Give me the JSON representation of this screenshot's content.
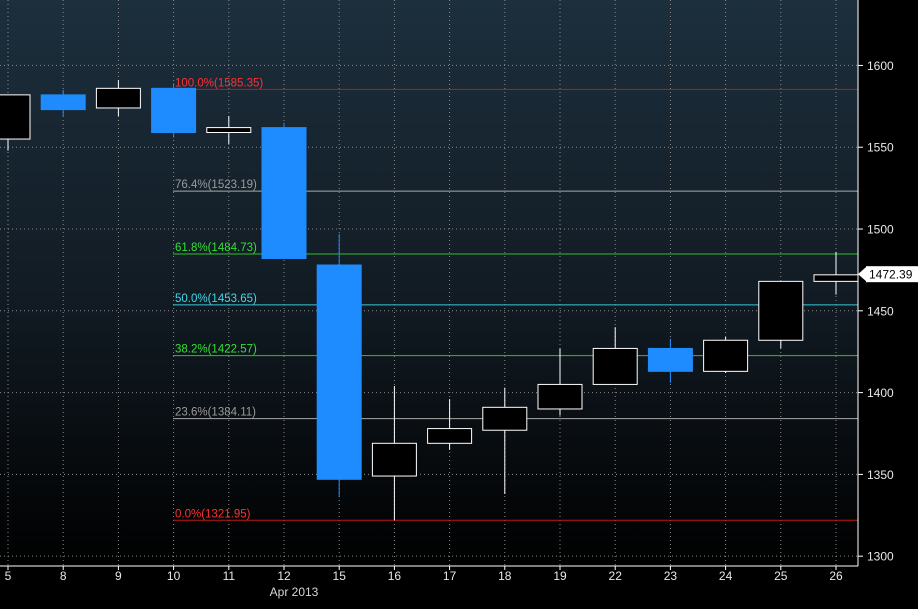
{
  "chart_data": {
    "type": "candlestick",
    "title": "",
    "xlabel": "Apr 2013",
    "ylabel": "",
    "ylim": [
      1294,
      1640
    ],
    "y_ticks": [
      1300,
      1350,
      1400,
      1450,
      1500,
      1550,
      1600
    ],
    "grid": true,
    "last_price_label": "1472.39",
    "last_price": 1472.39,
    "categories": [
      "5",
      "8",
      "9",
      "10",
      "11",
      "12",
      "15",
      "16",
      "17",
      "18",
      "19",
      "22",
      "23",
      "24",
      "25",
      "26"
    ],
    "candles": [
      {
        "x": "5",
        "open": 1555,
        "high": 1580,
        "low": 1548,
        "close": 1582,
        "color": "white"
      },
      {
        "x": "8",
        "open": 1582,
        "high": 1585,
        "low": 1569,
        "close": 1573,
        "color": "blue"
      },
      {
        "x": "9",
        "open": 1574,
        "high": 1591,
        "low": 1569,
        "close": 1586,
        "color": "white"
      },
      {
        "x": "10",
        "open": 1586,
        "high": 1589,
        "low": 1556,
        "close": 1559,
        "color": "blue"
      },
      {
        "x": "11",
        "open": 1559,
        "high": 1569,
        "low": 1552,
        "close": 1562,
        "color": "white"
      },
      {
        "x": "12",
        "open": 1562,
        "high": 1565,
        "low": 1482,
        "close": 1482,
        "color": "blue"
      },
      {
        "x": "15",
        "open": 1478,
        "high": 1497,
        "low": 1336,
        "close": 1347,
        "color": "blue"
      },
      {
        "x": "16",
        "open": 1349,
        "high": 1404,
        "low": 1322,
        "close": 1369,
        "color": "white"
      },
      {
        "x": "17",
        "open": 1369,
        "high": 1396,
        "low": 1365,
        "close": 1378,
        "color": "white"
      },
      {
        "x": "18",
        "open": 1377,
        "high": 1403,
        "low": 1338,
        "close": 1391,
        "color": "white"
      },
      {
        "x": "19",
        "open": 1390,
        "high": 1427,
        "low": 1386,
        "close": 1405,
        "color": "white"
      },
      {
        "x": "22",
        "open": 1405,
        "high": 1440,
        "low": 1405,
        "close": 1427,
        "color": "white"
      },
      {
        "x": "23",
        "open": 1427,
        "high": 1433,
        "low": 1406,
        "close": 1413,
        "color": "blue"
      },
      {
        "x": "24",
        "open": 1413,
        "high": 1434,
        "low": 1412,
        "close": 1432,
        "color": "white"
      },
      {
        "x": "25",
        "open": 1432,
        "high": 1468,
        "low": 1427,
        "close": 1468,
        "color": "white"
      },
      {
        "x": "26",
        "open": 1468,
        "high": 1486,
        "low": 1460,
        "close": 1472,
        "color": "white"
      }
    ],
    "fib_levels": [
      {
        "label": "100.0%(1585.35)",
        "value": 1585.35,
        "color": "#ff3030",
        "line": "#c01818"
      },
      {
        "label": "76.4%(1523.19)",
        "value": 1523.19,
        "color": "#9a9a9a",
        "line": "#a8a8a8"
      },
      {
        "label": "61.8%(1484.73)",
        "value": 1484.73,
        "color": "#33e033",
        "line": "#30c030"
      },
      {
        "label": "50.0%(1453.65)",
        "value": 1453.65,
        "color": "#40d8e8",
        "line": "#38c8d8"
      },
      {
        "label": "38.2%(1422.57)",
        "value": 1422.57,
        "color": "#33e033",
        "line": "#30c030"
      },
      {
        "label": "23.6%(1384.11)",
        "value": 1384.11,
        "color": "#9a9a9a",
        "line": "#a8a8a8"
      },
      {
        "label": "0.0%(1321.95)",
        "value": 1321.95,
        "color": "#ff3030",
        "line": "#c01818"
      }
    ],
    "colors": {
      "up_candle": "#ffffff",
      "down_candle": "#1e8cff",
      "background_top": "#1c2f3d",
      "background_bottom": "#000000",
      "grid": "#8a8a8a"
    }
  }
}
